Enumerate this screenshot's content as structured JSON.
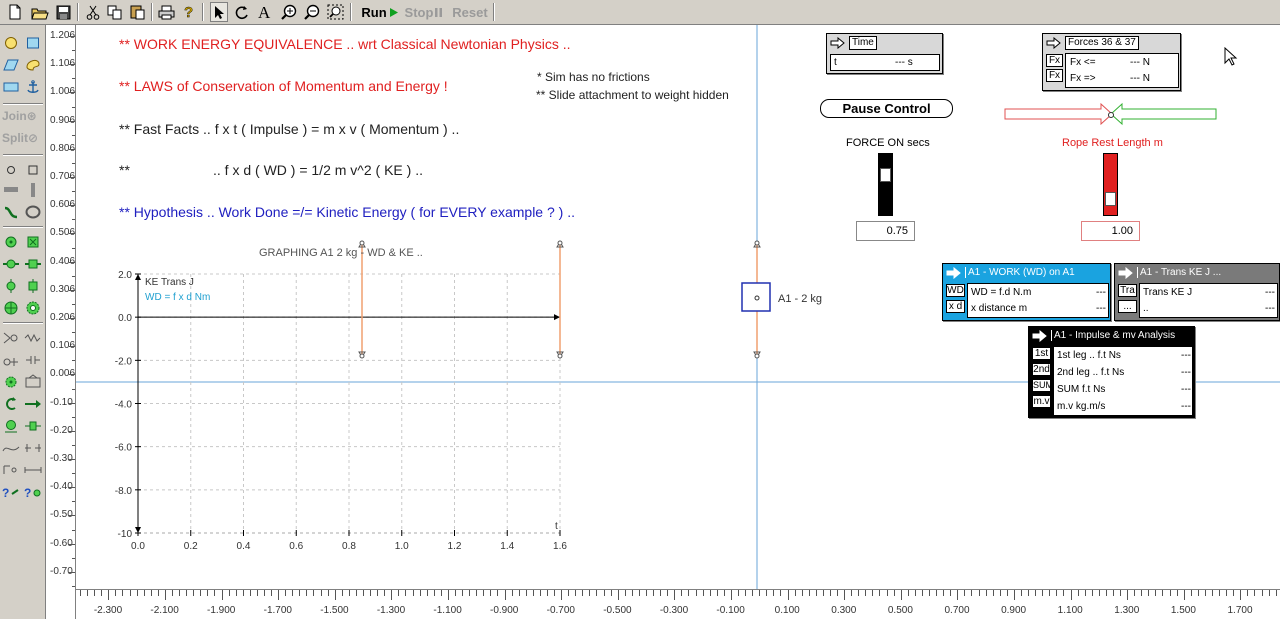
{
  "toolbar": {
    "run_label": "Run",
    "stop_label": "Stop",
    "reset_label": "Reset"
  },
  "palette": {
    "join_label": "Join",
    "split_label": "Split"
  },
  "vruler_labels": [
    "1.206",
    "1.106",
    "1.006",
    "0.906",
    "0.806",
    "0.706",
    "0.606",
    "0.506",
    "0.406",
    "0.306",
    "0.206",
    "0.106",
    "0.006",
    "-0.10",
    "-0.20",
    "-0.30",
    "-0.40",
    "-0.50",
    "-0.60",
    "-0.70"
  ],
  "hruler_labels": [
    "-2.300",
    "-2.100",
    "-1.900",
    "-1.700",
    "-1.500",
    "-1.300",
    "-1.100",
    "-0.900",
    "-0.700",
    "-0.500",
    "-0.300",
    "-0.100",
    "0.100",
    "0.300",
    "0.500",
    "0.700",
    "0.900",
    "1.100",
    "1.300",
    "1.500",
    "1.700"
  ],
  "canvas_text": {
    "line1": "** WORK ENERGY EQUIVALENCE .. wrt Classical Newtonian Physics ..",
    "line2": "** LAWS of Conservation of Momentum and Energy !",
    "note1": "* Sim has no frictions",
    "note2": "** Slide attachment to weight hidden",
    "line3": "** Fast Facts .. f x t  ( Impulse )  =  m x v  ( Momentum )  ..",
    "line4a": "**",
    "line4b": ".. f x d  ( WD )  =  1/2 m v^2  ( KE )  ..",
    "line5": "** Hypothesis .. Work Done =/= Kinetic Energy  ( for EVERY example   ? )  .."
  },
  "graph": {
    "title": "GRAPHING A1 2 kg - WD & KE ..",
    "legend_ke": "KE Trans J",
    "legend_wd": "WD = f x d Nm",
    "x_axis_label": "t"
  },
  "chart_data": {
    "type": "line",
    "title": "GRAPHING A1 2 kg - WD & KE ..",
    "xlabel": "t",
    "ylabel": "",
    "xlim": [
      0,
      1.6
    ],
    "ylim": [
      -10,
      2
    ],
    "x_ticks": [
      "0.0",
      "0.2",
      "0.4",
      "0.6",
      "0.8",
      "1.0",
      "1.2",
      "1.4",
      "1.6"
    ],
    "y_ticks": [
      "2.0",
      "0.0",
      "-2.0",
      "-4.0",
      "-6.0",
      "-8.0",
      "-10"
    ],
    "series": [
      {
        "name": "KE Trans J",
        "color": "#000000",
        "points": []
      },
      {
        "name": "WD = f x d Nm",
        "color": "#20a0d0",
        "points": []
      }
    ],
    "grid": true
  },
  "time_meter": {
    "title": "Time",
    "row_label": "t",
    "row_value": "--- s"
  },
  "forces_meter": {
    "title": "Forces 36 & 37",
    "btn1": "Fx",
    "btn2": "Fx",
    "row1_label": "Fx <=",
    "row1_value": "--- N",
    "row2_label": "Fx =>",
    "row2_value": "--- N"
  },
  "pause_label": "Pause Control",
  "force_slider": {
    "label": "FORCE ON secs",
    "value": "0.75",
    "level": 0.75
  },
  "rope_slider": {
    "label": "Rope Rest Length m",
    "value": "1.00",
    "level": 1.0
  },
  "body_label": "A1 - 2 kg",
  "wd_meter": {
    "title": "A1 - WORK (WD) on A1",
    "btn1": "WD",
    "btn2": "x d",
    "row1_label": "WD = f.d N.m",
    "row1_value": "---",
    "row2_label": "x distance m",
    "row2_value": "---"
  },
  "ke_meter": {
    "title": "A1 - Trans KE J ...",
    "btn1": "Tra",
    "btn2": "...",
    "row1_label": "Trans KE J",
    "row1_value": "---",
    "row2_label": "..",
    "row2_value": "---"
  },
  "impulse_meter": {
    "title": "A1 - Impulse & mv Analysis",
    "btns": [
      "1st",
      "2nd",
      "SUM",
      "m.v"
    ],
    "rows": [
      {
        "label": "1st leg .. f.t Ns",
        "value": "---"
      },
      {
        "label": "2nd leg .. f.t Ns",
        "value": "---"
      },
      {
        "label": "SUM f.t Ns",
        "value": "---"
      },
      {
        "label": "m.v kg.m/s",
        "value": "---"
      }
    ]
  },
  "colors": {
    "title_red": "#e02020",
    "hypothesis_blue": "#2020c0",
    "meter_blue": "#1aa3e0",
    "meter_gray": "#7a7a7a",
    "rope_red": "#e02020",
    "guide_blue": "#6aa6d8"
  }
}
